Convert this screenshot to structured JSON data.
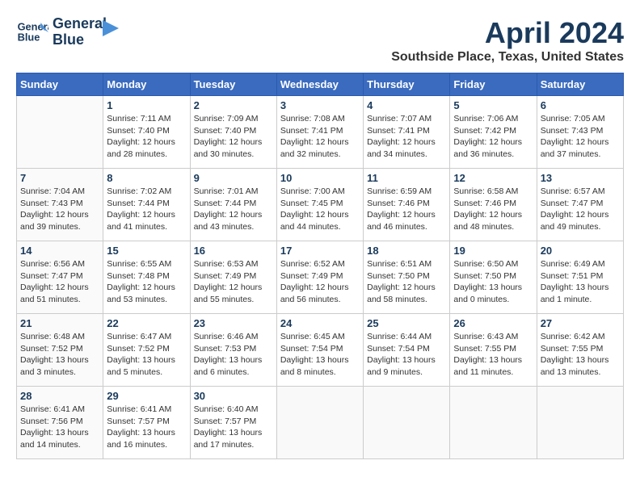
{
  "header": {
    "logo_line1": "General",
    "logo_line2": "Blue",
    "month_title": "April 2024",
    "subtitle": "Southside Place, Texas, United States"
  },
  "weekdays": [
    "Sunday",
    "Monday",
    "Tuesday",
    "Wednesday",
    "Thursday",
    "Friday",
    "Saturday"
  ],
  "weeks": [
    [
      {
        "day": "",
        "info": ""
      },
      {
        "day": "1",
        "info": "Sunrise: 7:11 AM\nSunset: 7:40 PM\nDaylight: 12 hours\nand 28 minutes."
      },
      {
        "day": "2",
        "info": "Sunrise: 7:09 AM\nSunset: 7:40 PM\nDaylight: 12 hours\nand 30 minutes."
      },
      {
        "day": "3",
        "info": "Sunrise: 7:08 AM\nSunset: 7:41 PM\nDaylight: 12 hours\nand 32 minutes."
      },
      {
        "day": "4",
        "info": "Sunrise: 7:07 AM\nSunset: 7:41 PM\nDaylight: 12 hours\nand 34 minutes."
      },
      {
        "day": "5",
        "info": "Sunrise: 7:06 AM\nSunset: 7:42 PM\nDaylight: 12 hours\nand 36 minutes."
      },
      {
        "day": "6",
        "info": "Sunrise: 7:05 AM\nSunset: 7:43 PM\nDaylight: 12 hours\nand 37 minutes."
      }
    ],
    [
      {
        "day": "7",
        "info": "Sunrise: 7:04 AM\nSunset: 7:43 PM\nDaylight: 12 hours\nand 39 minutes."
      },
      {
        "day": "8",
        "info": "Sunrise: 7:02 AM\nSunset: 7:44 PM\nDaylight: 12 hours\nand 41 minutes."
      },
      {
        "day": "9",
        "info": "Sunrise: 7:01 AM\nSunset: 7:44 PM\nDaylight: 12 hours\nand 43 minutes."
      },
      {
        "day": "10",
        "info": "Sunrise: 7:00 AM\nSunset: 7:45 PM\nDaylight: 12 hours\nand 44 minutes."
      },
      {
        "day": "11",
        "info": "Sunrise: 6:59 AM\nSunset: 7:46 PM\nDaylight: 12 hours\nand 46 minutes."
      },
      {
        "day": "12",
        "info": "Sunrise: 6:58 AM\nSunset: 7:46 PM\nDaylight: 12 hours\nand 48 minutes."
      },
      {
        "day": "13",
        "info": "Sunrise: 6:57 AM\nSunset: 7:47 PM\nDaylight: 12 hours\nand 49 minutes."
      }
    ],
    [
      {
        "day": "14",
        "info": "Sunrise: 6:56 AM\nSunset: 7:47 PM\nDaylight: 12 hours\nand 51 minutes."
      },
      {
        "day": "15",
        "info": "Sunrise: 6:55 AM\nSunset: 7:48 PM\nDaylight: 12 hours\nand 53 minutes."
      },
      {
        "day": "16",
        "info": "Sunrise: 6:53 AM\nSunset: 7:49 PM\nDaylight: 12 hours\nand 55 minutes."
      },
      {
        "day": "17",
        "info": "Sunrise: 6:52 AM\nSunset: 7:49 PM\nDaylight: 12 hours\nand 56 minutes."
      },
      {
        "day": "18",
        "info": "Sunrise: 6:51 AM\nSunset: 7:50 PM\nDaylight: 12 hours\nand 58 minutes."
      },
      {
        "day": "19",
        "info": "Sunrise: 6:50 AM\nSunset: 7:50 PM\nDaylight: 13 hours\nand 0 minutes."
      },
      {
        "day": "20",
        "info": "Sunrise: 6:49 AM\nSunset: 7:51 PM\nDaylight: 13 hours\nand 1 minute."
      }
    ],
    [
      {
        "day": "21",
        "info": "Sunrise: 6:48 AM\nSunset: 7:52 PM\nDaylight: 13 hours\nand 3 minutes."
      },
      {
        "day": "22",
        "info": "Sunrise: 6:47 AM\nSunset: 7:52 PM\nDaylight: 13 hours\nand 5 minutes."
      },
      {
        "day": "23",
        "info": "Sunrise: 6:46 AM\nSunset: 7:53 PM\nDaylight: 13 hours\nand 6 minutes."
      },
      {
        "day": "24",
        "info": "Sunrise: 6:45 AM\nSunset: 7:54 PM\nDaylight: 13 hours\nand 8 minutes."
      },
      {
        "day": "25",
        "info": "Sunrise: 6:44 AM\nSunset: 7:54 PM\nDaylight: 13 hours\nand 9 minutes."
      },
      {
        "day": "26",
        "info": "Sunrise: 6:43 AM\nSunset: 7:55 PM\nDaylight: 13 hours\nand 11 minutes."
      },
      {
        "day": "27",
        "info": "Sunrise: 6:42 AM\nSunset: 7:55 PM\nDaylight: 13 hours\nand 13 minutes."
      }
    ],
    [
      {
        "day": "28",
        "info": "Sunrise: 6:41 AM\nSunset: 7:56 PM\nDaylight: 13 hours\nand 14 minutes."
      },
      {
        "day": "29",
        "info": "Sunrise: 6:41 AM\nSunset: 7:57 PM\nDaylight: 13 hours\nand 16 minutes."
      },
      {
        "day": "30",
        "info": "Sunrise: 6:40 AM\nSunset: 7:57 PM\nDaylight: 13 hours\nand 17 minutes."
      },
      {
        "day": "",
        "info": ""
      },
      {
        "day": "",
        "info": ""
      },
      {
        "day": "",
        "info": ""
      },
      {
        "day": "",
        "info": ""
      }
    ]
  ]
}
